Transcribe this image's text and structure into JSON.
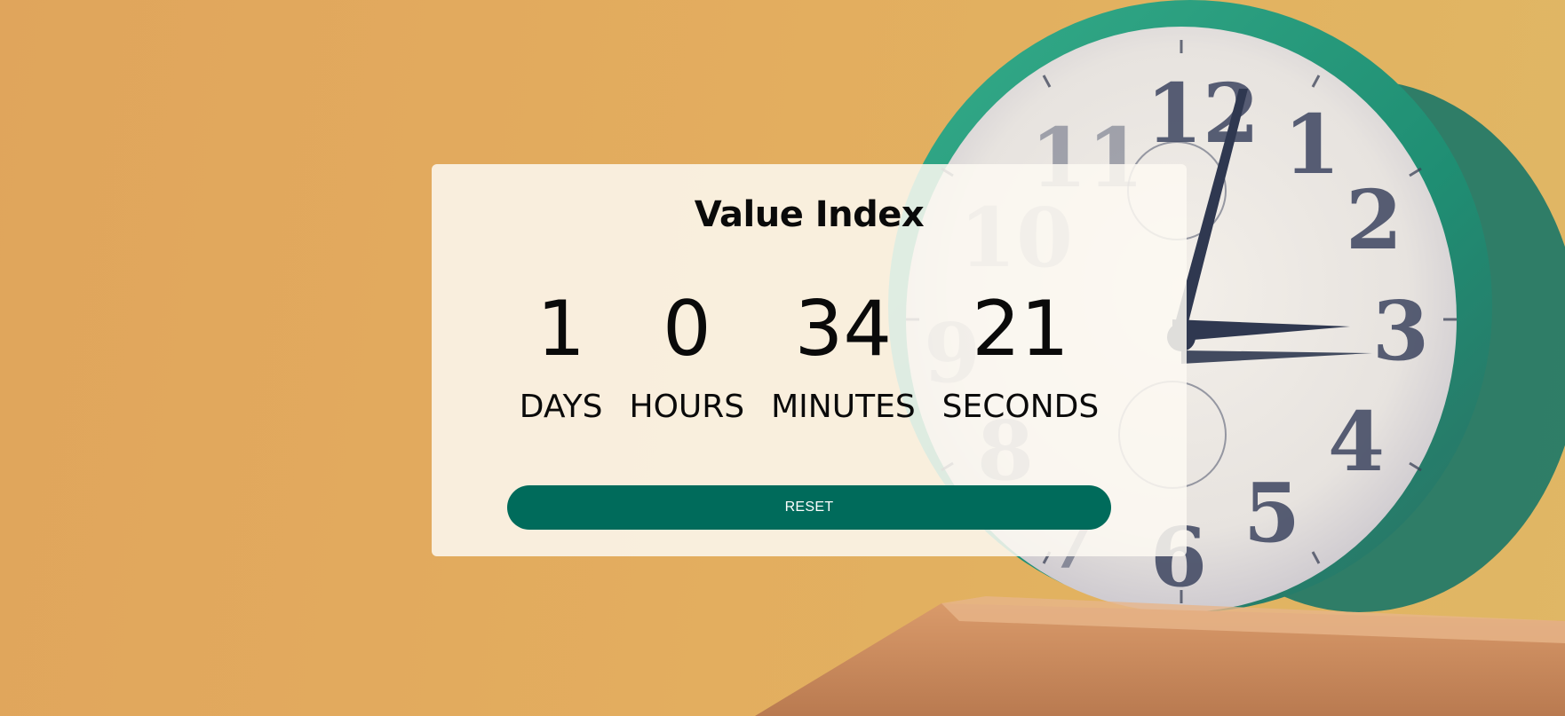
{
  "page": {
    "title": "Value Index"
  },
  "countdown": {
    "days": {
      "value": "1",
      "label": "DAYS"
    },
    "hours": {
      "value": "0",
      "label": "HOURS"
    },
    "minutes": {
      "value": "34",
      "label": "MINUTES"
    },
    "seconds": {
      "value": "21",
      "label": "SECONDS"
    }
  },
  "actions": {
    "reset_label": "RESET"
  },
  "colors": {
    "background": "#e0a55c",
    "card": "#fdf9f2",
    "button": "#006b5b",
    "clock_ring": "#2a9d7e",
    "text": "#0a0a0a"
  },
  "icons": {
    "background_image": "alarm-clock-photo"
  }
}
